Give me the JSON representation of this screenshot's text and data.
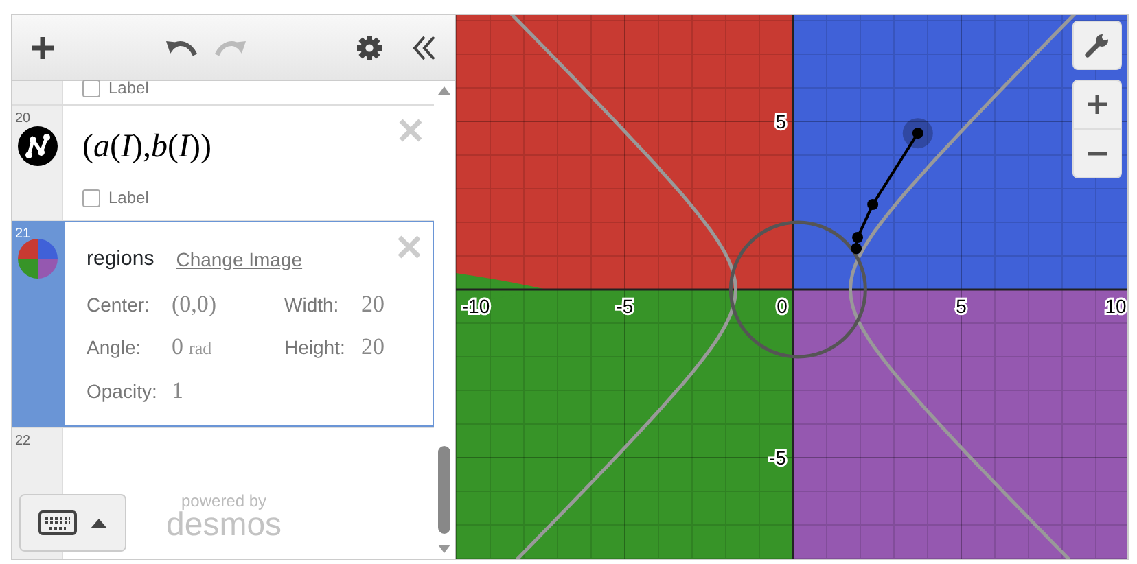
{
  "expressions": [
    {
      "kind": "label_only",
      "label": "Label",
      "checked": false
    },
    {
      "kind": "point",
      "number": "20",
      "latex": "(*a*(*I*),*b*(*I*))",
      "label": "Label",
      "checked": false,
      "selected": false
    },
    {
      "kind": "image",
      "number": "21",
      "name": "regions",
      "link": "Change Image",
      "selected": true,
      "fields": [
        {
          "label": "Center:",
          "value": "(0,0)"
        },
        {
          "label": "Width:",
          "value": "20"
        },
        {
          "label": "Angle:",
          "value": "0",
          "unit": "rad"
        },
        {
          "label": "Height:",
          "value": "20"
        },
        {
          "label": "Opacity:",
          "value": "1"
        }
      ]
    },
    {
      "kind": "empty",
      "number": "22",
      "selected": false
    }
  ],
  "branding": {
    "powered_by": "powered by",
    "logo": "desmos"
  },
  "graph": {
    "x_ticks": [
      "-10",
      "-5",
      "0",
      "5",
      "10"
    ],
    "y_ticks": [
      "5",
      "-5"
    ]
  }
}
